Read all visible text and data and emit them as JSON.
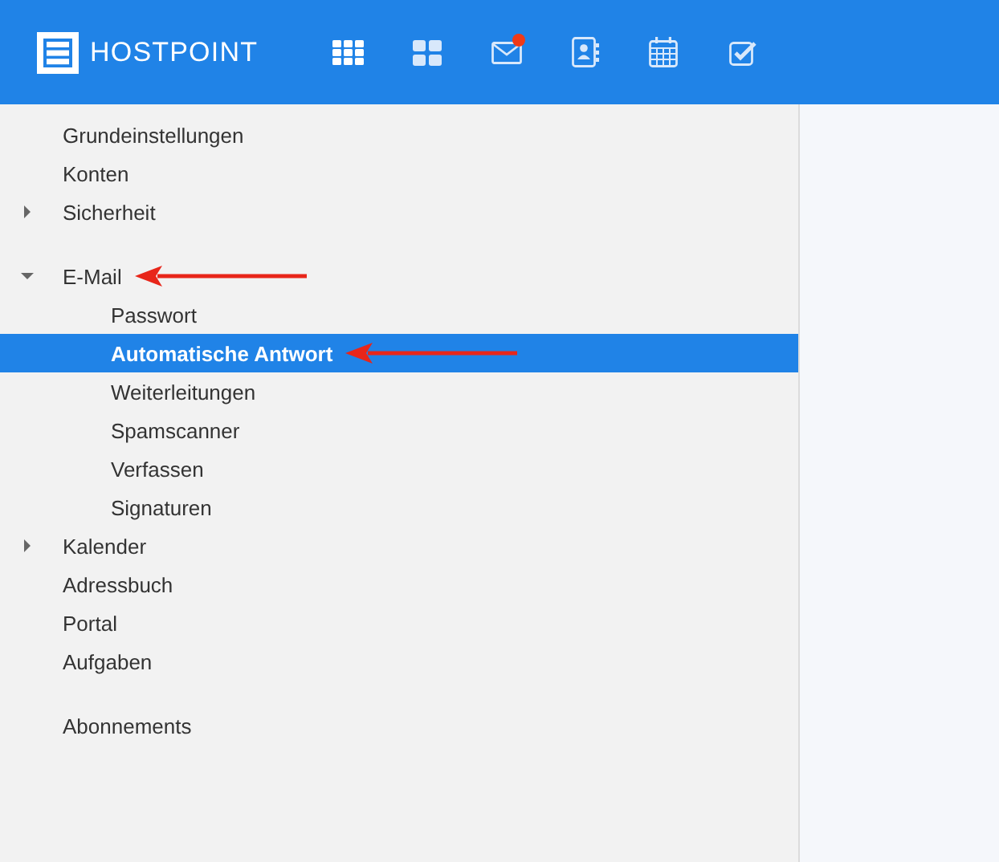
{
  "header": {
    "logo": "HOSTPOINT",
    "toolbar": [
      {
        "kind": "apps",
        "notification": false
      },
      {
        "kind": "portal",
        "notification": false
      },
      {
        "kind": "mail",
        "notification": true
      },
      {
        "kind": "contacts",
        "notification": false
      },
      {
        "kind": "calendar",
        "notification": false
      },
      {
        "kind": "tasks",
        "notification": false
      }
    ]
  },
  "sidebar": {
    "groups": [
      {
        "items": [
          {
            "label": "Grundeinstellungen",
            "selected": false
          },
          {
            "label": "Konten",
            "selected": false
          },
          {
            "label": "Sicherheit",
            "selected": false,
            "expanded": false
          }
        ]
      },
      {
        "items": [
          {
            "label": "E-Mail",
            "selected": false,
            "expanded": true,
            "annotated": true,
            "children": [
              {
                "label": "Passwort",
                "selected": false
              },
              {
                "label": "Automatische Antwort",
                "selected": true,
                "annotated": true
              },
              {
                "label": "Weiterleitungen",
                "selected": false
              },
              {
                "label": "Spamscanner",
                "selected": false
              },
              {
                "label": "Verfassen",
                "selected": false
              },
              {
                "label": "Signaturen",
                "selected": false
              }
            ]
          },
          {
            "label": "Kalender",
            "selected": false,
            "expanded": false
          },
          {
            "label": "Adressbuch",
            "selected": false
          },
          {
            "label": "Portal",
            "selected": false
          },
          {
            "label": "Aufgaben",
            "selected": false
          }
        ]
      },
      {
        "items": [
          {
            "label": "Abonnements",
            "selected": false
          }
        ]
      }
    ]
  }
}
